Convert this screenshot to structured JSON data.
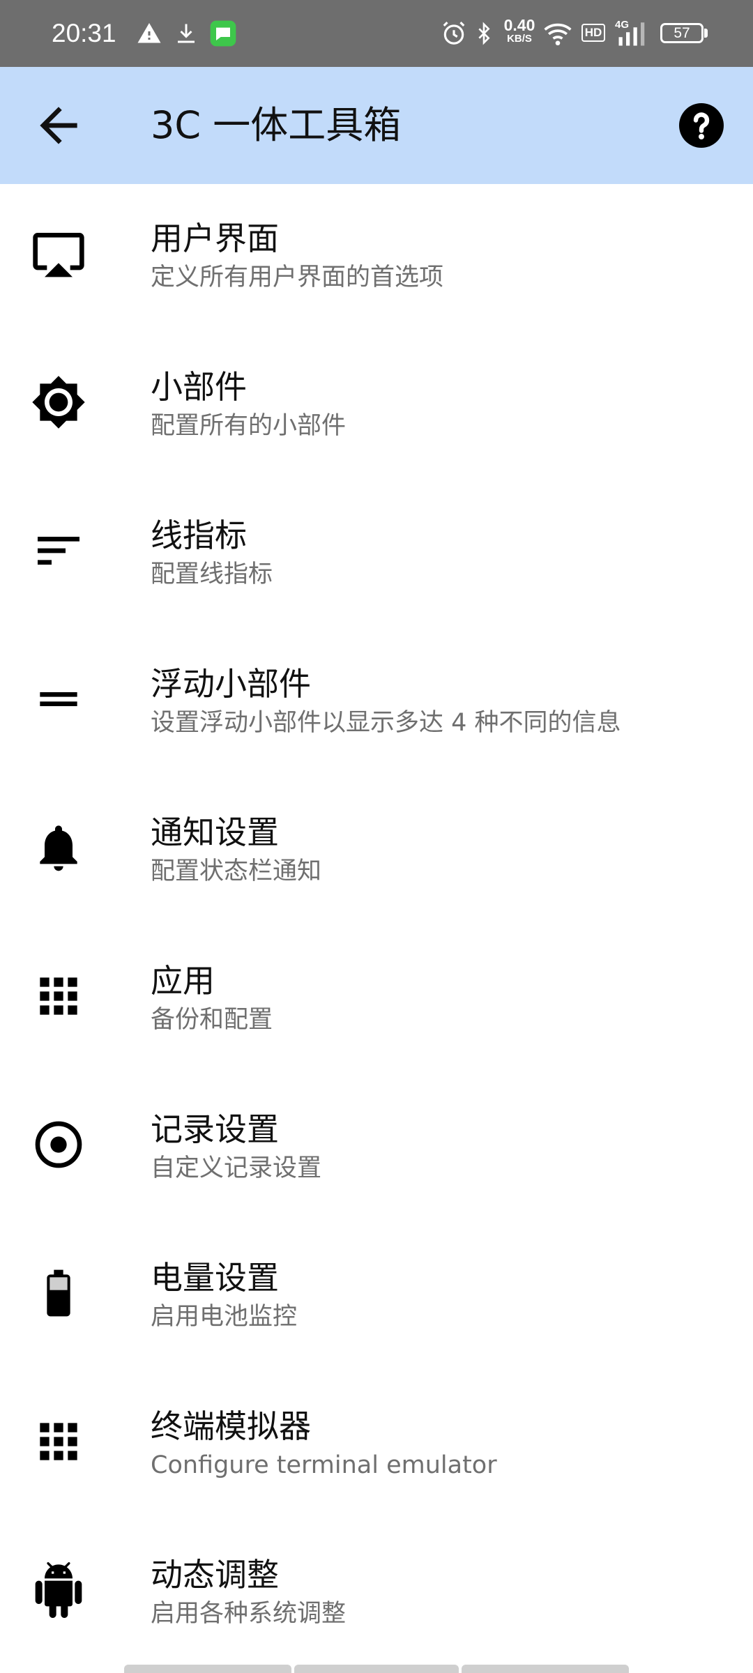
{
  "status_bar": {
    "time": "20:31",
    "net_speed_value": "0.40",
    "net_speed_unit": "KB/S",
    "hd_label": "HD",
    "network_label": "4G",
    "battery_level": "57",
    "icons": [
      "warning-icon",
      "download-icon",
      "message-app-icon",
      "alarm-icon",
      "bluetooth-icon",
      "wifi-icon",
      "hd-icon",
      "signal-icon",
      "battery-icon"
    ]
  },
  "app_bar": {
    "title": "3C 一体工具箱",
    "back_icon": "arrow-left-icon",
    "help_icon": "help-circle-icon",
    "background_color": "#c2dbfa"
  },
  "menu": {
    "items": [
      {
        "title": "用户界面",
        "subtitle": "定义所有用户界面的首选项",
        "icon": "cast-screen-icon"
      },
      {
        "title": "小部件",
        "subtitle": "配置所有的小部件",
        "icon": "brightness-icon"
      },
      {
        "title": "线指标",
        "subtitle": "配置线指标",
        "icon": "sort-lines-icon"
      },
      {
        "title": "浮动小部件",
        "subtitle": "设置浮动小部件以显示多达 4 种不同的信息",
        "icon": "equals-icon"
      },
      {
        "title": "通知设置",
        "subtitle": "配置状态栏通知",
        "icon": "bell-icon"
      },
      {
        "title": "应用",
        "subtitle": "备份和配置",
        "icon": "apps-grid-icon"
      },
      {
        "title": "记录设置",
        "subtitle": "自定义记录设置",
        "icon": "record-icon"
      },
      {
        "title": "电量设置",
        "subtitle": "启用电池监控",
        "icon": "battery-icon"
      },
      {
        "title": "终端模拟器",
        "subtitle": "Configure terminal emulator",
        "icon": "apps-grid-icon"
      },
      {
        "title": "动态调整",
        "subtitle": "启用各种系统调整",
        "icon": "android-icon"
      }
    ]
  }
}
